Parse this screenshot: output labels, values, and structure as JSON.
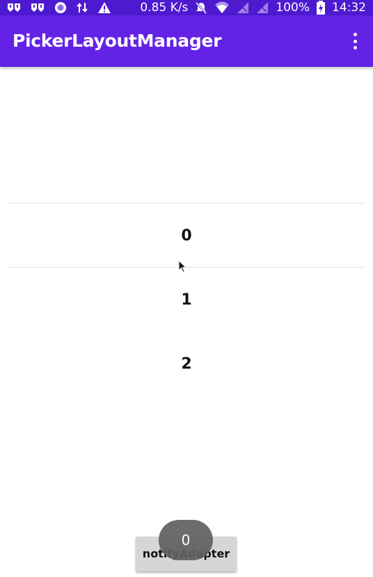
{
  "status_bar": {
    "network_speed": "0.85 K/s",
    "battery_percent": "100%",
    "time": "14:32",
    "left_icons": [
      "app-notification-icon",
      "app-notification-icon",
      "record-icon",
      "data-transfer-icon",
      "warning-icon"
    ],
    "right_icons": [
      "bell-off-icon",
      "wifi-icon",
      "no-signal-icon",
      "no-signal-icon",
      "battery-charging-icon"
    ]
  },
  "app_bar": {
    "title": "PickerLayoutManager",
    "menu_icon": "more-vert-icon"
  },
  "picker": {
    "items": [
      "0",
      "1",
      "2"
    ],
    "selected_index": 0
  },
  "notify_button": {
    "label": "notifyAdapter"
  },
  "toast": {
    "text": "0"
  },
  "colors": {
    "status_bar": "#4d1ad0",
    "app_bar": "#6422e6",
    "background": "#ffffff",
    "divider": "#e2e2e2",
    "button": "#d6d6d6",
    "toast": "#606060"
  }
}
